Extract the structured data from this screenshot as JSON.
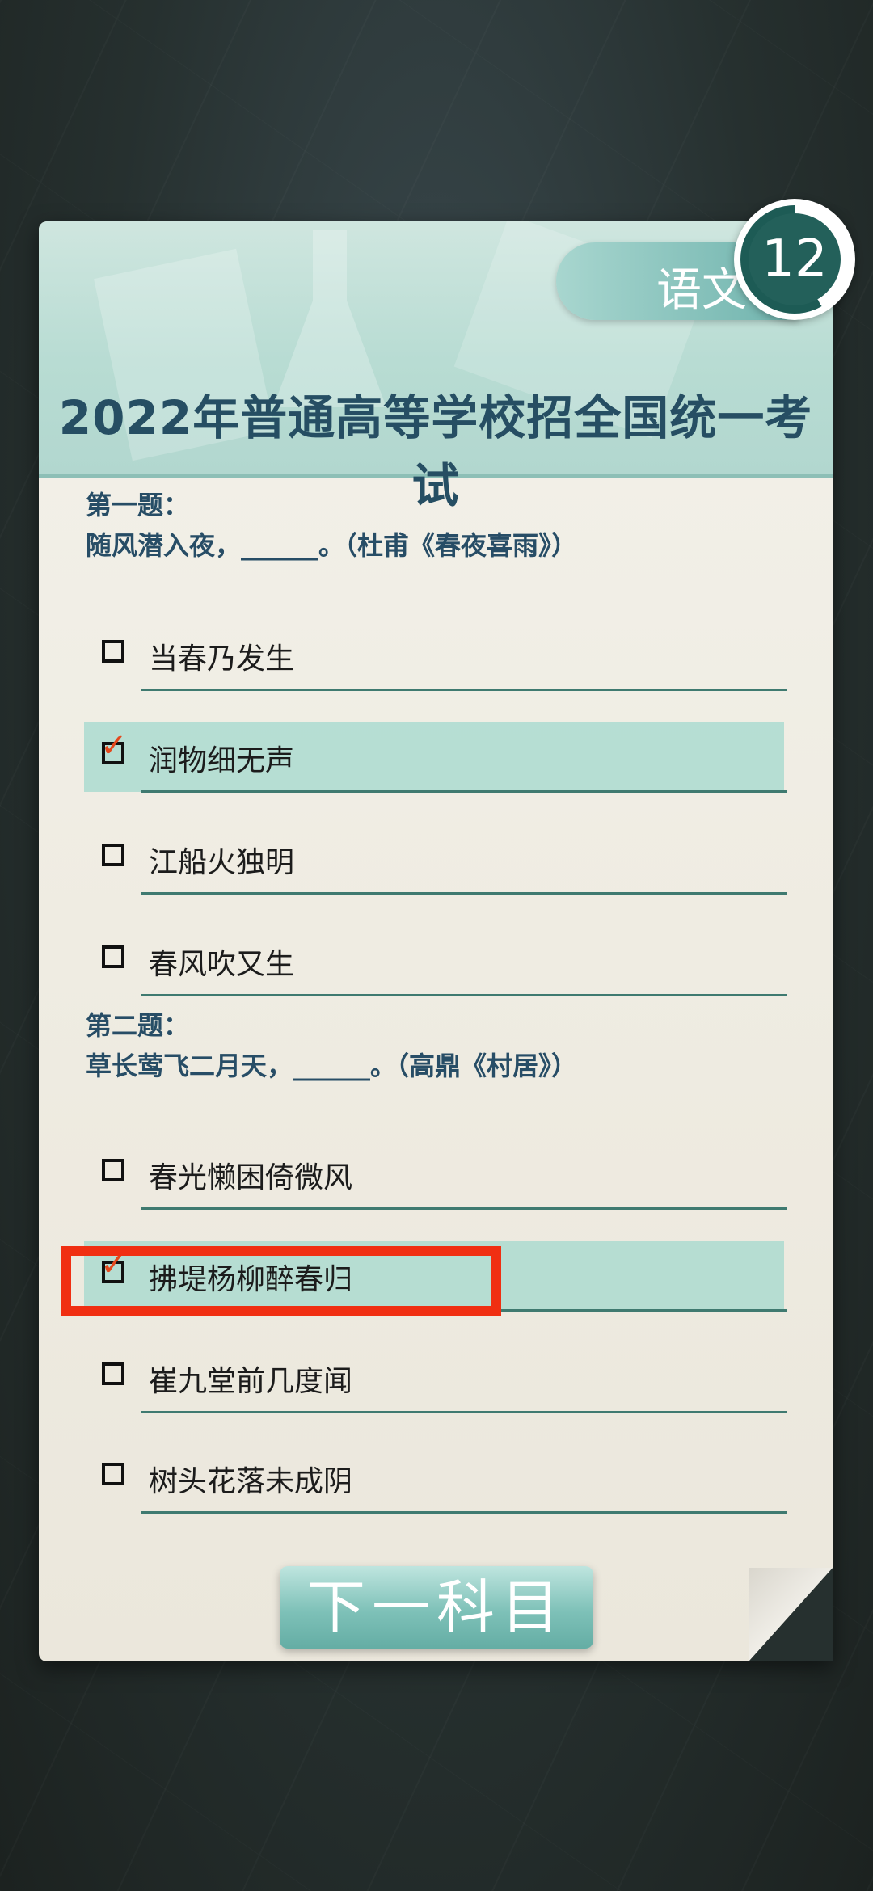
{
  "subject": "语文",
  "timer": "12",
  "exam_title": "2022年普通高等学校招全国统一考试",
  "questions": [
    {
      "label": "第一题：",
      "prompt": "随风潜入夜，______。（杜甫《春夜喜雨》）",
      "options": [
        {
          "text": "当春乃发生",
          "selected": false
        },
        {
          "text": "润物细无声",
          "selected": true
        },
        {
          "text": "江船火独明",
          "selected": false
        },
        {
          "text": "春风吹又生",
          "selected": false
        }
      ]
    },
    {
      "label": "第二题：",
      "prompt": "草长莺飞二月天，______。（高鼎《村居》）",
      "options": [
        {
          "text": "春光懒困倚微风",
          "selected": false
        },
        {
          "text": "拂堤杨柳醉春归",
          "selected": true
        },
        {
          "text": "崔九堂前几度闻",
          "selected": false
        },
        {
          "text": "树头花落未成阴",
          "selected": false
        }
      ]
    }
  ],
  "next_button": "下一科目",
  "colors": {
    "highlight": "#f02f12",
    "accent": "#264e63",
    "check": "#e5481c"
  }
}
